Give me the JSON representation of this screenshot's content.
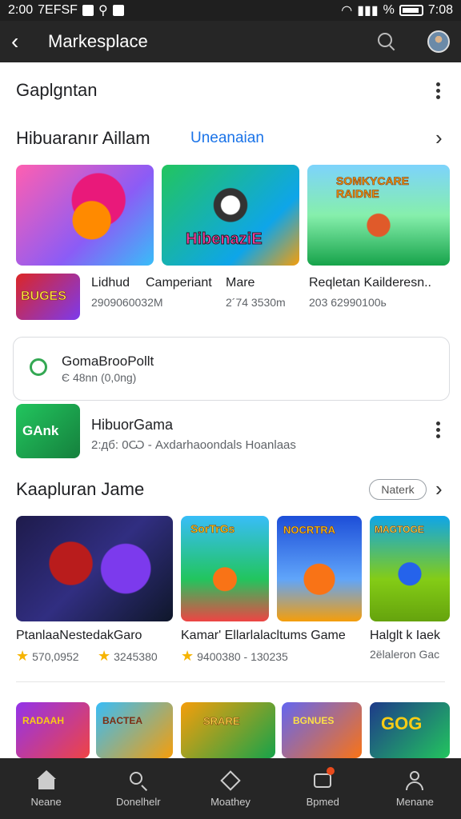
{
  "status_bar": {
    "time_left": "2:00",
    "left_text": "7EFSF",
    "time_right": "7:08"
  },
  "app_bar": {
    "title": "Markesplace"
  },
  "section1": {
    "title": "Gaplgntan"
  },
  "section2": {
    "title": "Hibuaranır Aillam",
    "subtitle": "Uneanaian"
  },
  "row1": [
    {
      "label": "Lidhud",
      "meta": "2909060032M",
      "art": "BUGES"
    },
    {
      "label": "Camperiant",
      "meta": "2´74 3530m"
    },
    {
      "label": "Mare"
    },
    {
      "label": "Reqletan Kailderesn..",
      "meta": "203 62990100ь"
    }
  ],
  "card": {
    "title": "GomaBrooPollt",
    "subtitle": "Є 48nn (0,0ng)"
  },
  "app_row": {
    "icon_text": "GAnk",
    "title": "HibuorGama",
    "meta": "2:дб: 0Ѡ - Axdarhaoondals Hoanlaas"
  },
  "section3": {
    "title": "Kaapluran Jame",
    "pill": "Naterk"
  },
  "row2": [
    {
      "label": "PtanlaaNestedakGaro",
      "rating": "570,0952"
    },
    {
      "label": "",
      "rating": "3245380"
    },
    {
      "label": "Kamar' Ellarlalacltums Game",
      "rating": "9400380 - 130235"
    },
    {
      "label": "Halglt k Iaek",
      "meta": "2ёlaleron Gac"
    }
  ],
  "row2_tile_text": [
    "",
    "SorTrGs",
    "NOCRTRA",
    "MAGTOGE"
  ],
  "row3_tile_text": [
    "RADAAH",
    "BACTEA",
    "SRARE",
    "BGNUES",
    "GOG"
  ],
  "nav": [
    {
      "label": "Neane",
      "icon": "home-icon"
    },
    {
      "label": "Donelhelr",
      "icon": "search-icon"
    },
    {
      "label": "Moathey",
      "icon": "diamond-icon"
    },
    {
      "label": "Bpmed",
      "icon": "inbox-icon"
    },
    {
      "label": "Menane",
      "icon": "person-icon"
    }
  ]
}
